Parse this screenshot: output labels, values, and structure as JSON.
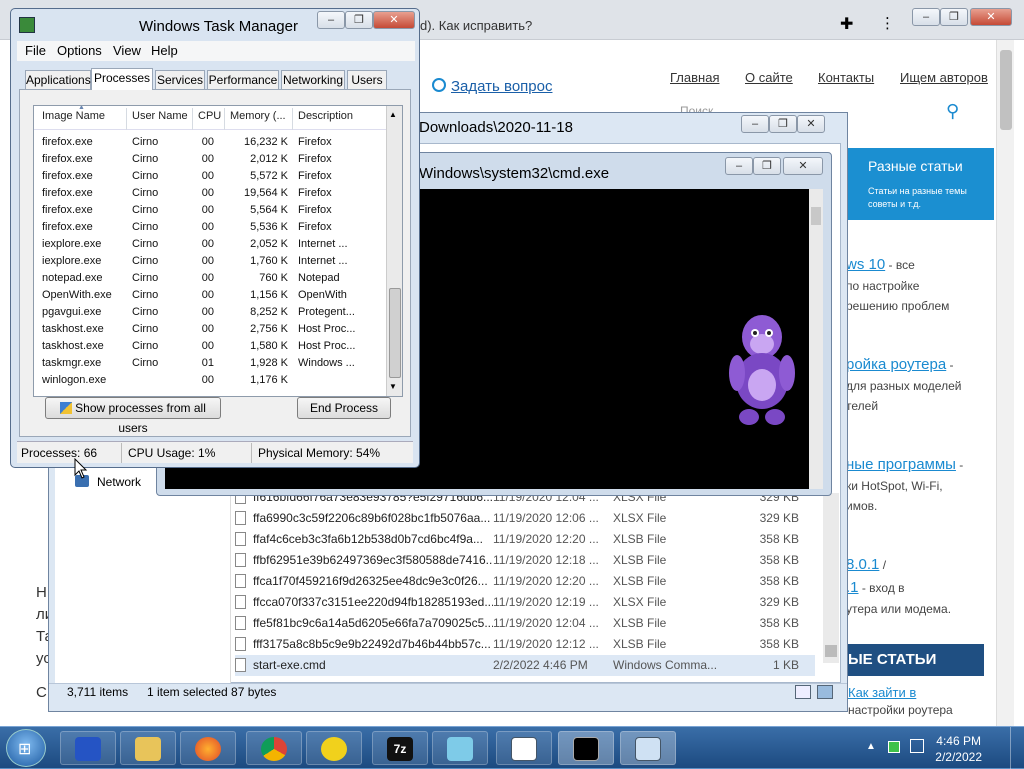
{
  "browser": {
    "url_fragment": "d). Как исправить?",
    "ask_link": "Задать вопрос",
    "nav": [
      "Главная",
      "О сайте",
      "Контакты",
      "Ищем авторов"
    ],
    "search_placeholder": "Поиск",
    "card_title": "Разные статьи",
    "card_sub1": "Статьи на разные темы",
    "card_sub2": "советы и т.д.",
    "side": [
      {
        "link": "ws 10",
        "text": " - все",
        "t2": "по настройке",
        "t3": "решению проблем"
      },
      {
        "link": "ройка роутера",
        "text": " -",
        "t2": "для разных моделей",
        "t3": "телей"
      },
      {
        "link": "ные программы",
        "text": " -",
        "t2": "ки HotSpot, Wi-Fi,",
        "t3": "имов."
      },
      {
        "link": "8.0.1",
        "text": " /",
        "t2": ".1",
        "t2b": " - вход в",
        "t3": "утера или модема."
      }
    ],
    "dark_header": "ЫЕ СТАТЬИ",
    "howto_link": "Как зайти в",
    "howto_text": "настройки роутера",
    "left_letters": [
      "Н",
      "ли",
      "Та",
      "ус",
      "С"
    ]
  },
  "explorer": {
    "title": "Downloads\\2020-11-18",
    "nav_network": "Network",
    "items_count": "3,711 items",
    "selected": "1 item selected  87 bytes",
    "files": [
      {
        "name": "ff616bfd66f76a73e83e93785?e5f29716db6...",
        "date": "11/19/2020 12:04 ...",
        "type": "XLSX File",
        "size": "329 KB"
      },
      {
        "name": "ffa6990c3c59f2206c89b6f028bc1fb5076aa...",
        "date": "11/19/2020 12:06 ...",
        "type": "XLSX File",
        "size": "329 KB"
      },
      {
        "name": "ffaf4c6ceb3c3fa6b12b538d0b7cd6bc4f9a...",
        "date": "11/19/2020 12:20 ...",
        "type": "XLSB File",
        "size": "358 KB"
      },
      {
        "name": "ffbf62951e39b62497369ec3f580588de7416...",
        "date": "11/19/2020 12:18 ...",
        "type": "XLSB File",
        "size": "358 KB"
      },
      {
        "name": "ffca1f70f459216f9d26325ee48dc9e3c0f26...",
        "date": "11/19/2020 12:20 ...",
        "type": "XLSB File",
        "size": "358 KB"
      },
      {
        "name": "ffcca070f337c3151ee220d94fb18285193ed...",
        "date": "11/19/2020 12:19 ...",
        "type": "XLSX File",
        "size": "329 KB"
      },
      {
        "name": "ffe5f81bc9c6a14a5d6205e66fa7a709025c5...",
        "date": "11/19/2020 12:04 ...",
        "type": "XLSB File",
        "size": "358 KB"
      },
      {
        "name": "fff3175a8c8b5c9e9b22492d7b46b44bb57c...",
        "date": "11/19/2020 12:12 ...",
        "type": "XLSB File",
        "size": "358 KB"
      },
      {
        "name": "start-exe.cmd",
        "date": "2/2/2022 4:46 PM",
        "type": "Windows Comma...",
        "size": "1 KB"
      }
    ]
  },
  "cmd": {
    "title": "Windows\\system32\\cmd.exe"
  },
  "taskmgr": {
    "title": "Windows Task Manager",
    "menu": [
      "File",
      "Options",
      "View",
      "Help"
    ],
    "tabs": [
      "Applications",
      "Processes",
      "Services",
      "Performance",
      "Networking",
      "Users"
    ],
    "columns": [
      "Image Name",
      "User Name",
      "CPU",
      "Memory (...",
      "Description"
    ],
    "processes": [
      {
        "name": "firefox.exe",
        "user": "Cirno",
        "cpu": "00",
        "mem": "16,232 K",
        "desc": "Firefox"
      },
      {
        "name": "firefox.exe",
        "user": "Cirno",
        "cpu": "00",
        "mem": "2,012 K",
        "desc": "Firefox"
      },
      {
        "name": "firefox.exe",
        "user": "Cirno",
        "cpu": "00",
        "mem": "5,572 K",
        "desc": "Firefox"
      },
      {
        "name": "firefox.exe",
        "user": "Cirno",
        "cpu": "00",
        "mem": "19,564 K",
        "desc": "Firefox"
      },
      {
        "name": "firefox.exe",
        "user": "Cirno",
        "cpu": "00",
        "mem": "5,564 K",
        "desc": "Firefox"
      },
      {
        "name": "firefox.exe",
        "user": "Cirno",
        "cpu": "00",
        "mem": "5,536 K",
        "desc": "Firefox"
      },
      {
        "name": "iexplore.exe",
        "user": "Cirno",
        "cpu": "00",
        "mem": "2,052 K",
        "desc": "Internet ..."
      },
      {
        "name": "iexplore.exe",
        "user": "Cirno",
        "cpu": "00",
        "mem": "1,760 K",
        "desc": "Internet ..."
      },
      {
        "name": "notepad.exe",
        "user": "Cirno",
        "cpu": "00",
        "mem": "760 K",
        "desc": "Notepad"
      },
      {
        "name": "OpenWith.exe",
        "user": "Cirno",
        "cpu": "00",
        "mem": "1,156 K",
        "desc": "OpenWith"
      },
      {
        "name": "pgavgui.exe",
        "user": "Cirno",
        "cpu": "00",
        "mem": "8,252 K",
        "desc": "Protegent..."
      },
      {
        "name": "taskhost.exe",
        "user": "Cirno",
        "cpu": "00",
        "mem": "2,756 K",
        "desc": "Host Proc..."
      },
      {
        "name": "taskhost.exe",
        "user": "Cirno",
        "cpu": "00",
        "mem": "1,580 K",
        "desc": "Host Proc..."
      },
      {
        "name": "taskmgr.exe",
        "user": "Cirno",
        "cpu": "01",
        "mem": "1,928 K",
        "desc": "Windows ..."
      },
      {
        "name": "winlogon.exe",
        "user": "",
        "cpu": "00",
        "mem": "1,176 K",
        "desc": ""
      }
    ],
    "show_all_btn": "Show processes from all users",
    "end_btn": "End Process",
    "status_processes": "Processes: 66",
    "status_cpu": "CPU Usage: 1%",
    "status_mem": "Physical Memory: 54%"
  },
  "taskbar": {
    "time": "4:46 PM",
    "date": "2/2/2022",
    "apps": [
      "start-orb",
      "network-app-icon",
      "explorer-icon",
      "firefox-icon",
      "chrome-icon",
      "protegent-icon",
      "7zip-icon",
      "notepad-icon",
      "list-app-icon",
      "cmd-icon",
      "taskmgr-icon"
    ]
  },
  "colors": {
    "accent": "#1b8fd1",
    "taskbar": "#1c4a80",
    "title_text": "#000000"
  }
}
